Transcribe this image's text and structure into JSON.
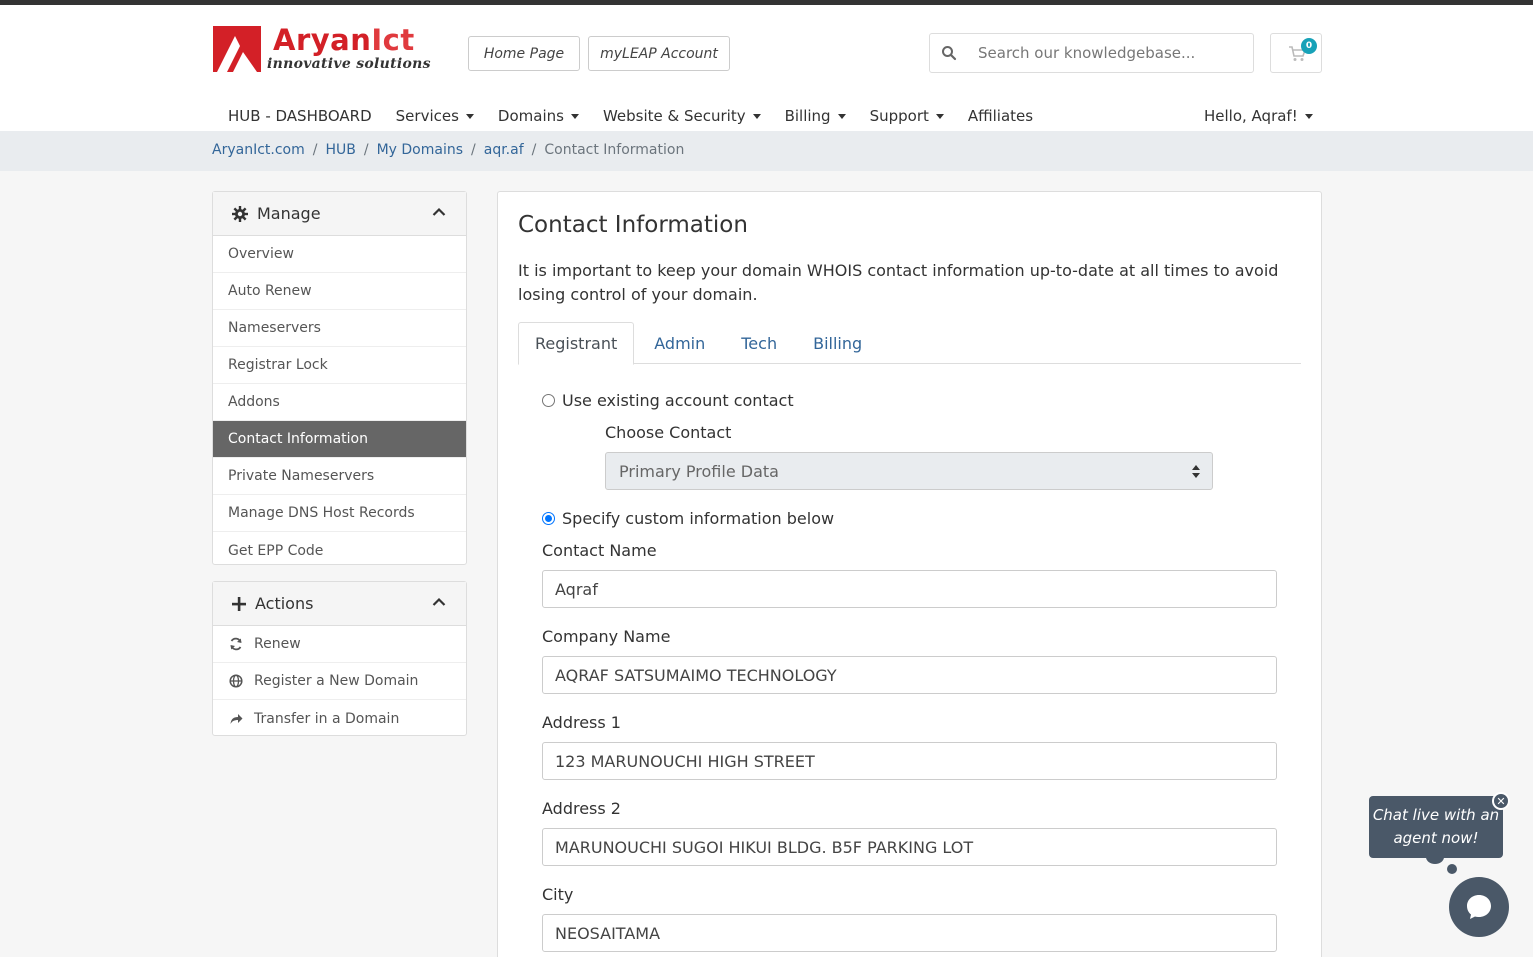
{
  "brand": {
    "name_main": "Aryan",
    "name_suffix": "Ict",
    "tagline": "innovative solutions"
  },
  "header": {
    "home_button": "Home Page",
    "account_button": "myLEAP Account",
    "search_placeholder": "Search our knowledgebase...",
    "cart_count": "0"
  },
  "nav": {
    "items": [
      {
        "label": "HUB - DASHBOARD",
        "dropdown": false
      },
      {
        "label": "Services",
        "dropdown": true
      },
      {
        "label": "Domains",
        "dropdown": true
      },
      {
        "label": "Website & Security",
        "dropdown": true
      },
      {
        "label": "Billing",
        "dropdown": true
      },
      {
        "label": "Support",
        "dropdown": true
      },
      {
        "label": "Affiliates",
        "dropdown": false
      }
    ],
    "user_greeting": "Hello, Aqraf!"
  },
  "breadcrumb": [
    "AryanIct.com",
    "HUB",
    "My Domains",
    "aqr.af",
    "Contact Information"
  ],
  "sidebar": {
    "manage": {
      "title": "Manage",
      "items": [
        "Overview",
        "Auto Renew",
        "Nameservers",
        "Registrar Lock",
        "Addons",
        "Contact Information",
        "Private Nameservers",
        "Manage DNS Host Records",
        "Get EPP Code"
      ],
      "active": "Contact Information"
    },
    "actions": {
      "title": "Actions",
      "items": [
        "Renew",
        "Register a New Domain",
        "Transfer in a Domain"
      ]
    }
  },
  "main": {
    "title": "Contact Information",
    "intro": "It is important to keep your domain WHOIS contact information up-to-date at all times to avoid losing control of your domain.",
    "tabs": [
      "Registrant",
      "Admin",
      "Tech",
      "Billing"
    ],
    "active_tab": "Registrant",
    "option_existing": "Use existing account contact",
    "choose_contact_label": "Choose Contact",
    "choose_contact_value": "Primary Profile Data",
    "option_custom": "Specify custom information below",
    "fields": {
      "contact_name": {
        "label": "Contact Name",
        "value": "Aqraf"
      },
      "company_name": {
        "label": "Company Name",
        "value": "AQRAF SATSUMAIMO TECHNOLOGY"
      },
      "address1": {
        "label": "Address 1",
        "value": "123 MARUNOUCHI HIGH STREET"
      },
      "address2": {
        "label": "Address 2",
        "value": "MARUNOUCHI SUGOI HIKUI BLDG. B5F PARKING LOT"
      },
      "city": {
        "label": "City",
        "value": "NEOSAITAMA"
      }
    }
  },
  "chat": {
    "prompt": "Chat live with an agent now!"
  },
  "colors": {
    "brand_red": "#d32027",
    "link": "#336699",
    "active_item": "#666666",
    "chat": "#4a5868"
  }
}
